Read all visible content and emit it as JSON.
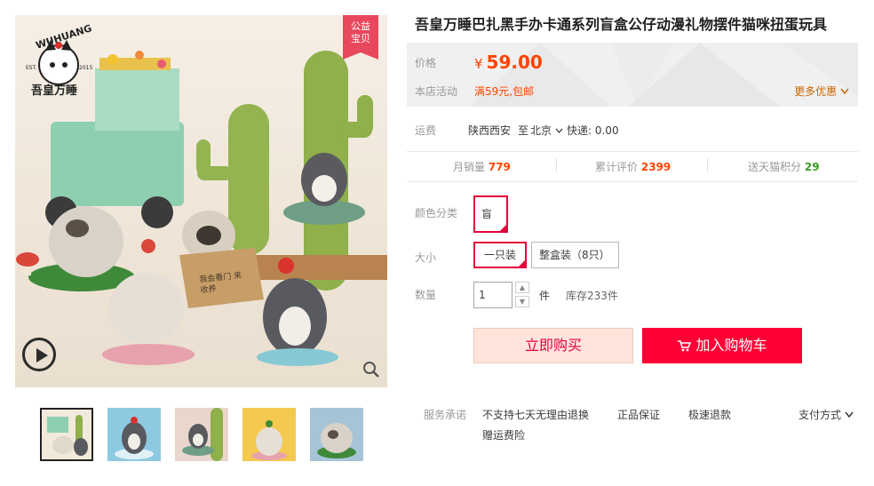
{
  "gallery": {
    "badge_line1": "公益",
    "badge_line2": "宝贝",
    "logo_brand": "WUHUANG",
    "logo_cn": "吾皇万睡",
    "logo_est": "EST.",
    "logo_year": "2015",
    "box_text": "我会看门 来收养",
    "thumbnails": 5,
    "selected_thumbnail": 1
  },
  "product": {
    "title": "吾皇万睡巴扎黑手办卡通系列盲盒公仔动漫礼物摆件猫咪扭蛋玩具"
  },
  "price": {
    "label": "价格",
    "currency": "¥",
    "value": "59.00",
    "promo_label": "本店活动",
    "promo_text": "满59元,包邮",
    "more_label": "更多优惠"
  },
  "shipping": {
    "label": "运费",
    "from": "陕西西安",
    "to_word": "至",
    "to_city": "北京",
    "fee": "快递: 0.00"
  },
  "stats": {
    "monthly_label": "月销量",
    "monthly_value": "779",
    "reviews_label": "累计评价",
    "reviews_value": "2399",
    "points_label": "送天猫积分",
    "points_value": "29"
  },
  "options": {
    "color_label": "颜色分类",
    "color_value": "盲盒",
    "size_label": "大小",
    "size_options": [
      "一只装",
      "整盒装（8只）"
    ],
    "qty_label": "数量",
    "qty_value": "1",
    "qty_unit": "件",
    "stock": "库存233件"
  },
  "actions": {
    "buy_now": "立即购买",
    "add_cart": "加入购物车"
  },
  "service": {
    "label": "服务承诺",
    "items": [
      "不支持七天无理由退换",
      "正品保证",
      "极速退款",
      "赠运费险"
    ],
    "payment": "支付方式"
  },
  "colors": {
    "accent": "#ff0036",
    "price": "#ff4400",
    "green": "#3a9d23"
  }
}
